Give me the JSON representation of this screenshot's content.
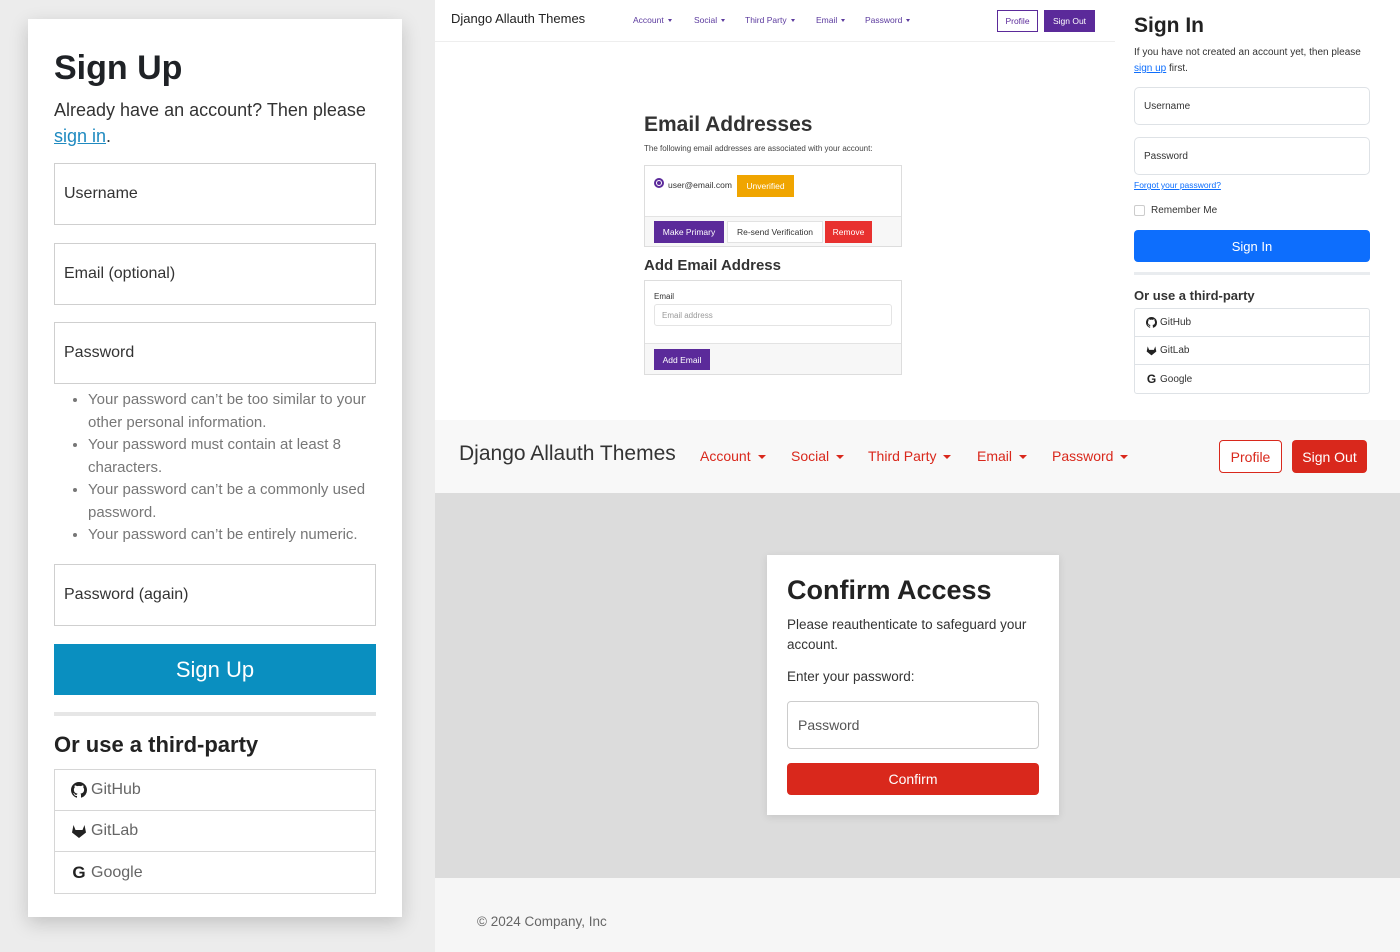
{
  "signup": {
    "title": "Sign Up",
    "intro_prefix": "Already have an account? Then please ",
    "intro_link": "sign in",
    "intro_suffix": ".",
    "fields": {
      "username": "Username",
      "email": "Email (optional)",
      "password": "Password",
      "password2": "Password (again)"
    },
    "help": [
      "Your password can’t be too similar to your other personal information.",
      "Your password must contain at least 8 characters.",
      "Your password can’t be a commonly used password.",
      "Your password can’t be entirely numeric."
    ],
    "submit": "Sign Up",
    "third_party_title": "Or use a third-party",
    "providers": [
      {
        "label": "GitHub",
        "icon": "github-icon"
      },
      {
        "label": "GitLab",
        "icon": "gitlab-icon"
      },
      {
        "label": "Google",
        "icon": "google-icon"
      }
    ],
    "accent": "#0a8fc0"
  },
  "email_page": {
    "brand": "Django Allauth Themes",
    "menu": [
      "Account",
      "Social",
      "Third Party",
      "Email",
      "Password"
    ],
    "profile": "Profile",
    "sign_out": "Sign Out",
    "title": "Email Addresses",
    "description": "The following email addresses are associated with your account:",
    "address": "user@email.com",
    "badge": "Unverified",
    "actions": {
      "primary": "Make Primary",
      "resend": "Re-send Verification",
      "remove": "Remove"
    },
    "add_title": "Add Email Address",
    "add_label": "Email",
    "add_placeholder": "Email address",
    "add_button": "Add Email",
    "accent": "#5b2a9a"
  },
  "signin": {
    "title": "Sign In",
    "intro_prefix": "If you have not created an account yet, then please ",
    "intro_link": "sign up",
    "intro_suffix": " first.",
    "username_placeholder": "Username",
    "password_placeholder": "Password",
    "forgot": "Forgot your password?",
    "remember": "Remember Me",
    "submit": "Sign In",
    "third_party_title": "Or use a third-party",
    "providers": [
      {
        "label": "GitHub",
        "icon": "github-icon"
      },
      {
        "label": "GitLab",
        "icon": "gitlab-icon"
      },
      {
        "label": "Google",
        "icon": "google-icon"
      }
    ],
    "accent": "#0d6efd"
  },
  "confirm_page": {
    "brand": "Django Allauth Themes",
    "menu": [
      "Account",
      "Social",
      "Third Party",
      "Email",
      "Password"
    ],
    "profile": "Profile",
    "sign_out": "Sign Out",
    "title": "Confirm Access",
    "description": "Please reauthenticate to safeguard your account.",
    "label": "Enter your password:",
    "password_placeholder": "Password",
    "submit": "Confirm",
    "footer": "© 2024 Company, Inc",
    "accent": "#d9281c"
  }
}
